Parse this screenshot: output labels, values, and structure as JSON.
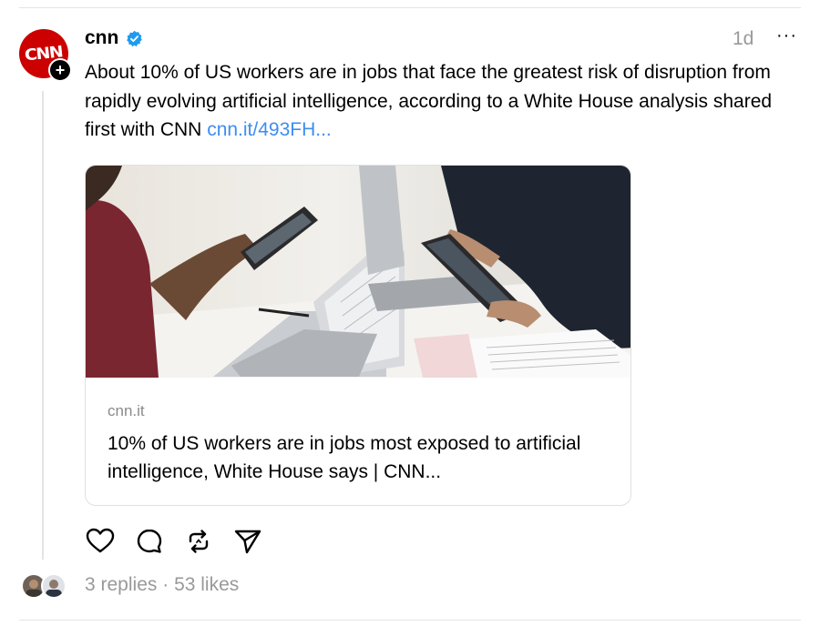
{
  "post": {
    "avatar_logo_text": "CNN",
    "username": "cnn",
    "timestamp": "1d",
    "more_label": "···",
    "text": "About 10% of US workers are in jobs that face the greatest risk of disruption from rapidly evolving artificial intelligence, according to a White House analysis shared first with CNN ",
    "link_text": "cnn.it/493FH..."
  },
  "link_card": {
    "domain": "cnn.it",
    "title": "10% of US workers are in jobs most exposed to artificial intelligence, White House says | CNN..."
  },
  "actions": {
    "like_icon": "heart-icon",
    "reply_icon": "comment-icon",
    "repost_icon": "repost-icon",
    "share_icon": "send-icon"
  },
  "footer": {
    "replies": "3 replies",
    "separator": "·",
    "likes": "53 likes"
  },
  "colors": {
    "brand": "#cc0000",
    "link": "#3d8ef0",
    "verified": "#1d9bf0",
    "muted": "#999999"
  }
}
